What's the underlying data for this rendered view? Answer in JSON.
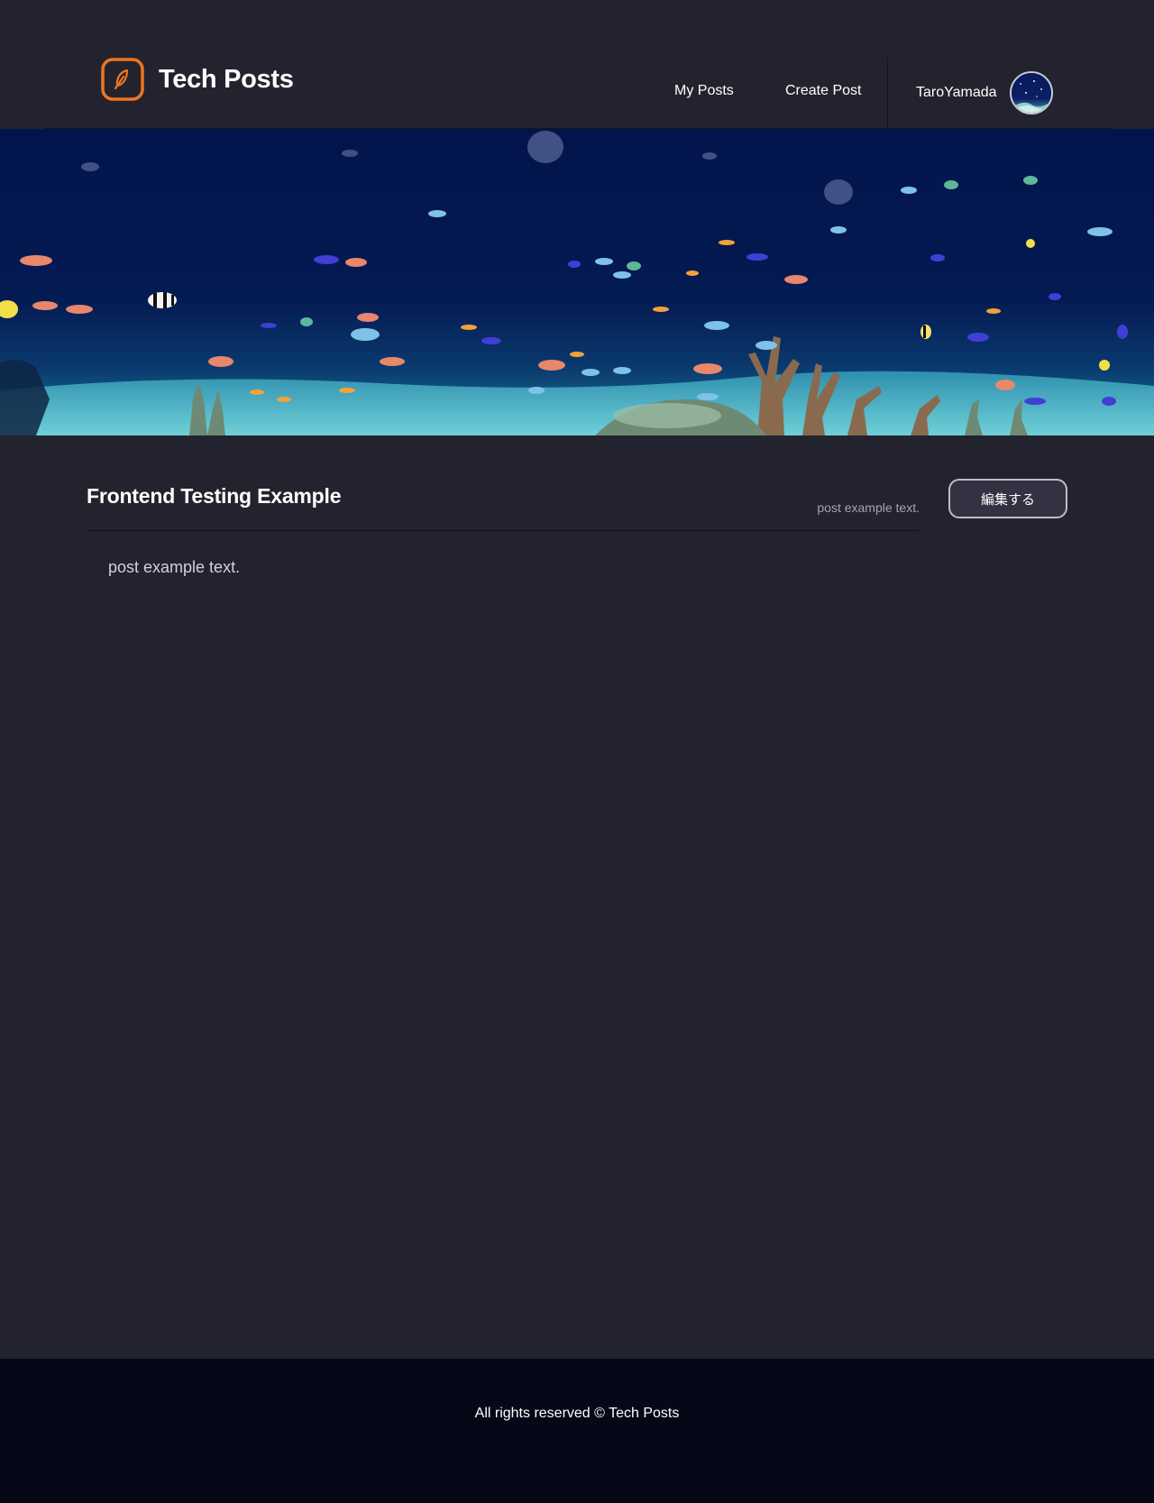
{
  "header": {
    "brand": "Tech Posts",
    "nav": {
      "my_posts": "My Posts",
      "create_post": "Create Post"
    },
    "user": {
      "name": "TaroYamada"
    }
  },
  "hero": {
    "icon": "aquarium-image"
  },
  "post": {
    "title": "Frontend Testing Example",
    "meta": "post example text.",
    "edit_label": "編集する",
    "body": "post example text."
  },
  "footer": {
    "text": "All rights reserved © Tech Posts"
  },
  "colors": {
    "background": "#23232f",
    "footer_background": "#050816",
    "logo_accent": "#ef7420",
    "text": "#ffffff",
    "muted_text": "#a3a3b4"
  }
}
